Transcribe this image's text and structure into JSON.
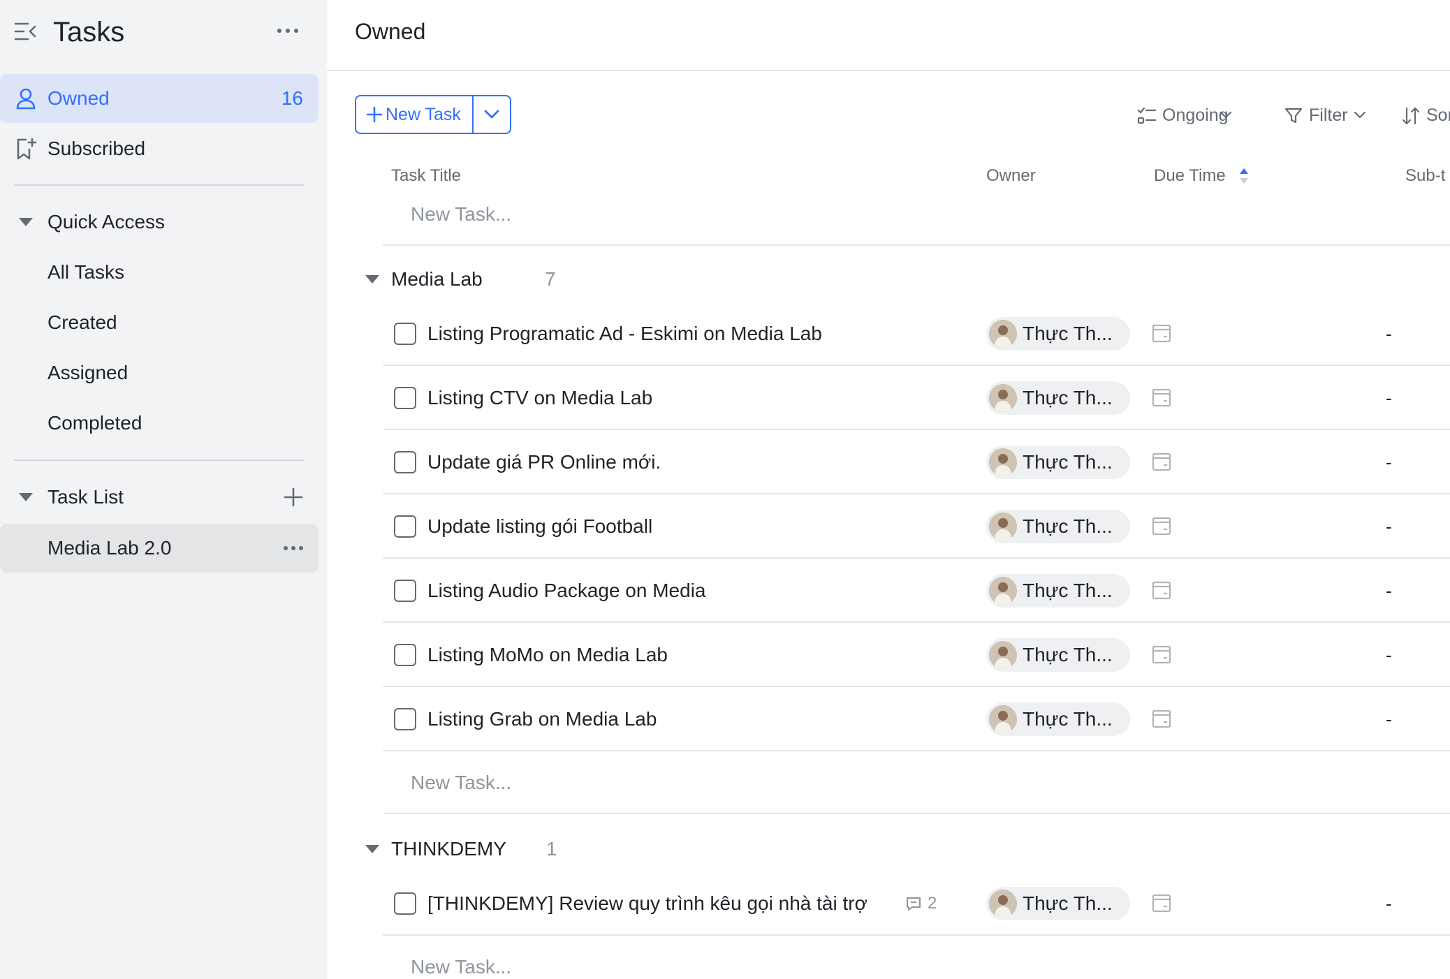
{
  "sidebar": {
    "title": "Tasks",
    "nav": [
      {
        "label": "Owned",
        "count": "16",
        "active": true
      },
      {
        "label": "Subscribed"
      }
    ],
    "quick_access": {
      "label": "Quick Access",
      "items": [
        "All Tasks",
        "Created",
        "Assigned",
        "Completed"
      ]
    },
    "task_list": {
      "label": "Task List",
      "items": [
        "Media Lab 2.0"
      ]
    }
  },
  "main": {
    "title": "Owned",
    "new_task_button": "New Task",
    "toolbar": {
      "ongoing": "Ongoing",
      "filter": "Filter",
      "sort": "Sor"
    },
    "columns": {
      "title": "Task Title",
      "owner": "Owner",
      "due": "Due Time",
      "subtask": "Sub-t"
    },
    "new_task_placeholder": "New Task...",
    "groups": [
      {
        "name": "Media Lab",
        "count": "7",
        "tasks": [
          {
            "title": "Listing Programatic Ad - Eskimi on Media Lab",
            "owner": "Thực Th...",
            "subtask": "-"
          },
          {
            "title": "Listing CTV on Media Lab",
            "owner": "Thực Th...",
            "subtask": "-"
          },
          {
            "title": "Update giá PR Online mới.",
            "owner": "Thực Th...",
            "subtask": "-"
          },
          {
            "title": "Update listing gói Football",
            "owner": "Thực Th...",
            "subtask": "-"
          },
          {
            "title": "Listing Audio Package on Media",
            "owner": "Thực Th...",
            "subtask": "-"
          },
          {
            "title": "Listing MoMo on Media Lab",
            "owner": "Thực Th...",
            "subtask": "-"
          },
          {
            "title": "Listing Grab on Media Lab",
            "owner": "Thực Th...",
            "subtask": "-"
          }
        ]
      },
      {
        "name": "THINKDEMY",
        "count": "1",
        "tasks": [
          {
            "title": "[THINKDEMY] Review quy trình kêu gọi nhà tài trợ",
            "comments": "2",
            "owner": "Thực Th...",
            "subtask": "-"
          }
        ]
      }
    ]
  },
  "colors": {
    "accent": "#3370ff",
    "sidebar_bg": "#f2f3f5",
    "active_bg": "#dde4f7",
    "selected_bg": "#e4e5e7",
    "muted_text": "#8f959e",
    "divider": "#e5e6eb"
  }
}
